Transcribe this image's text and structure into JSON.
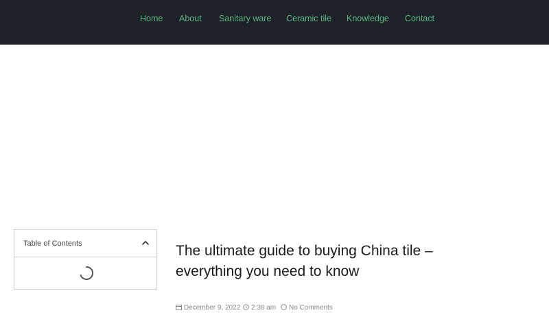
{
  "nav": {
    "items": [
      {
        "label": "Home",
        "key": "home"
      },
      {
        "label": "About",
        "key": "about"
      },
      {
        "label": "Sanitary ware",
        "key": "sanitary-ware"
      },
      {
        "label": "Ceramic tile",
        "key": "ceramic-tile"
      },
      {
        "label": "Knowledge",
        "key": "knowledge"
      },
      {
        "label": "Contact",
        "key": "contact"
      }
    ],
    "link_color": "#5fb584",
    "bar_color": "#1d2229"
  },
  "toc": {
    "title": "Table of Contents",
    "toggle_icon": "chevron-up-icon",
    "loading_icon": "spinner-icon"
  },
  "post": {
    "title": "The ultimate guide to buying China tile – everything you need to know",
    "meta": {
      "date": "December 9, 2022",
      "time": "2:38 am",
      "comments": "No Comments"
    }
  }
}
